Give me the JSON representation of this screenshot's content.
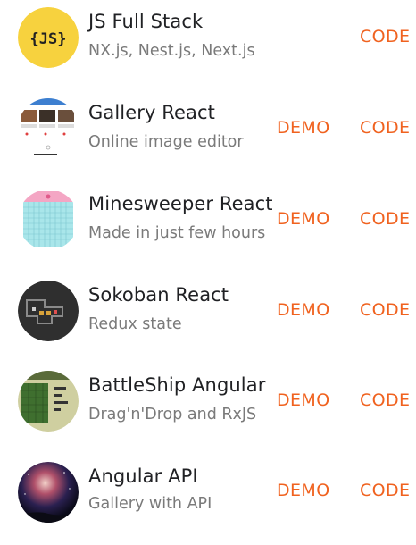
{
  "projects": [
    {
      "title": "JS Full Stack",
      "subtitle": "NX.js, Nest.js, Next.js",
      "demo": null,
      "code": "CODE",
      "thumbnail_icon": "js-logo-icon",
      "thumbnail_text": "{JS}",
      "thumbnail_color": "#f7d23e"
    },
    {
      "title": "Gallery React",
      "subtitle": "Online image editor",
      "demo": "DEMO",
      "code": "CODE",
      "thumbnail_icon": "image-gallery-thumbnail"
    },
    {
      "title": "Minesweeper React",
      "subtitle": "Made in just few hours",
      "demo": "DEMO",
      "code": "CODE",
      "thumbnail_icon": "minesweeper-grid-thumbnail"
    },
    {
      "title": "Sokoban React",
      "subtitle": "Redux state",
      "demo": "DEMO",
      "code": "CODE",
      "thumbnail_icon": "sokoban-map-thumbnail"
    },
    {
      "title": "BattleShip Angular",
      "subtitle": "Drag'n'Drop and RxJS",
      "demo": "DEMO",
      "code": "CODE",
      "thumbnail_icon": "battleship-board-thumbnail"
    },
    {
      "title": "Angular API",
      "subtitle": "Gallery with API",
      "demo": "DEMO",
      "code": "CODE",
      "thumbnail_icon": "galaxy-photo-thumbnail"
    }
  ],
  "colors": {
    "accent": "#f0621f",
    "title": "#202124",
    "subtitle": "#7a7a7a"
  }
}
